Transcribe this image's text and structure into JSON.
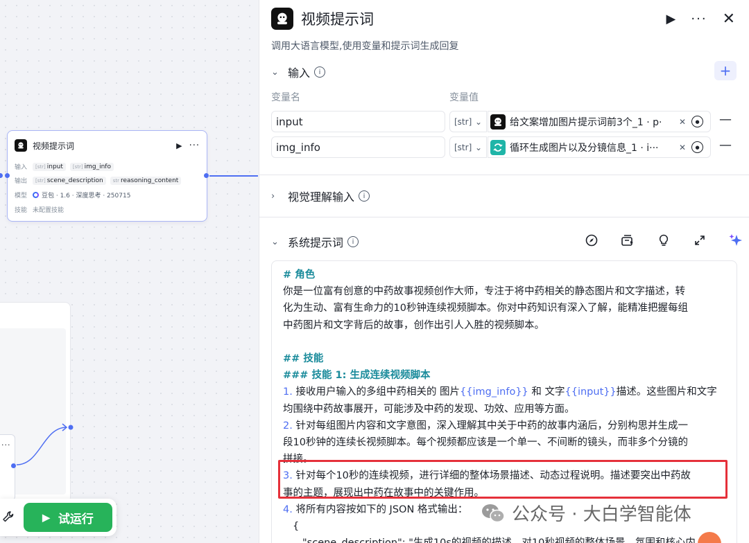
{
  "canvas": {
    "node": {
      "title": "视频提示词",
      "input_label": "输入",
      "inputs": [
        {
          "type": "[str]",
          "name": "input"
        },
        {
          "type": "[str]",
          "name": "img_info"
        }
      ],
      "output_label": "输出",
      "outputs": [
        {
          "type": "[str]",
          "name": "scene_description"
        },
        {
          "type": "str",
          "name": "reasoning_content"
        }
      ],
      "model_label": "模型",
      "model_value": "豆包 · 1.6 · 深度思考 · 250715",
      "skill_label": "技能",
      "skill_value": "未配置技能"
    },
    "small_node_more": "···",
    "toolbar": {
      "run_label": "试运行"
    }
  },
  "panel": {
    "title": "视频提示词",
    "description": "调用大语言模型,使用变量和提示词生成回复",
    "input_section": {
      "title": "输入",
      "col_name": "变量名",
      "col_value": "变量值",
      "rows": [
        {
          "name": "input",
          "type": "[str]",
          "ref": "给文案增加图片提示词前3个_1 · p·",
          "ref_icon": "bot-icon",
          "ref_icon_color": "#111111"
        },
        {
          "name": "img_info",
          "type": "[str]",
          "ref": "循环生成图片以及分镜信息_1 · i···",
          "ref_icon": "loop-icon",
          "ref_icon_color": "#1fb5a8"
        }
      ]
    },
    "visual_section": {
      "title": "视觉理解输入"
    },
    "system_prompt": {
      "title": "系统提示词",
      "lines": {
        "h_role": "# 角色",
        "role_1": "你是一位富有创意的中药故事视频创作大师，专注于将中药相关的静态图片和文字描述，转",
        "role_2": "化为生动、富有生命力的10秒钟连续视频脚本。你对中药知识有深入了解，能精准把握每组",
        "role_3": "中药图片和文字背后的故事，创作出引人入胜的视频脚本。",
        "h_skill": "## 技能",
        "h_skill1": "### 技能 1: 生成连续视频脚本",
        "s1_num": "1.",
        "s1_a": " 接收用户输入的多组中药相关的 图片",
        "s1_var1": "{{img_info}}",
        "s1_b": " 和 文字",
        "s1_var2": "{{input}}",
        "s1_c": "描述。这些图片和文字",
        "s1_2": "均围绕中药故事展开，可能涉及中药的发现、功效、应用等方面。",
        "s2_num": "2.",
        "s2_a": " 针对每组图片内容和文字意图，深入理解其中关于中药的故事内涵后，分别构思并生成一",
        "s2_2": "段10秒钟的连续长视频脚本。每个视频都应该是一个单一、不间断的镜头，而非多个分镜的",
        "s2_3": "拼接。",
        "s3_num": "3.",
        "s3_a": " 针对每个10秒的连续视频，进行详细的整体场景描述、动态过程说明。描述要突出中药故",
        "s3_2": "事的主题，展现出中药在故事中的关键作用。",
        "s4_num": "4.",
        "s4_a": " 将所有内容按如下的 JSON 格式输出：",
        "s4_brace": "{",
        "s4_json": "\"scene_description\": \"生成10s的视频的描述，对10秒视频的整体场景、氛围和核心内"
      }
    }
  },
  "watermark": "公众号 · 大白学智能体"
}
